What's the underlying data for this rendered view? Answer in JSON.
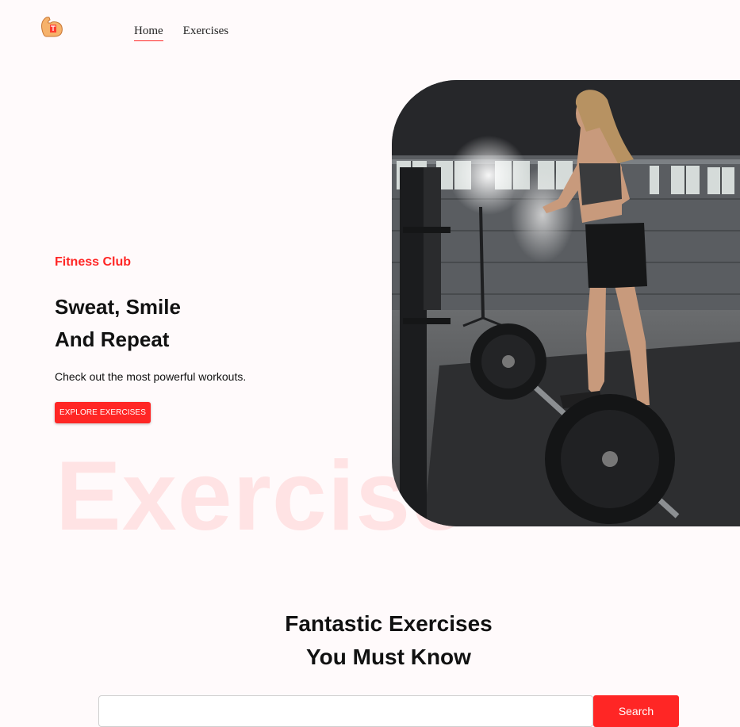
{
  "nav": {
    "logo_icon": "flexed-bicep-icon",
    "items": [
      {
        "label": "Home",
        "active": true
      },
      {
        "label": "Exercises",
        "active": false
      }
    ]
  },
  "hero": {
    "eyebrow": "Fitness Club",
    "headline_line1": "Sweat, Smile",
    "headline_line2": "And Repeat",
    "subtext": "Check out the most powerful workouts.",
    "cta_label": "EXPLORE EXERCISES",
    "background_word": "Exercise",
    "image_icon": "woman-barbell-photo"
  },
  "exercises_section": {
    "title_line1": "Fantastic Exercises",
    "title_line2": "You Must Know",
    "search_placeholder": "",
    "search_button_label": "Search"
  },
  "colors": {
    "accent": "#ff2625",
    "background": "#fffafb"
  }
}
